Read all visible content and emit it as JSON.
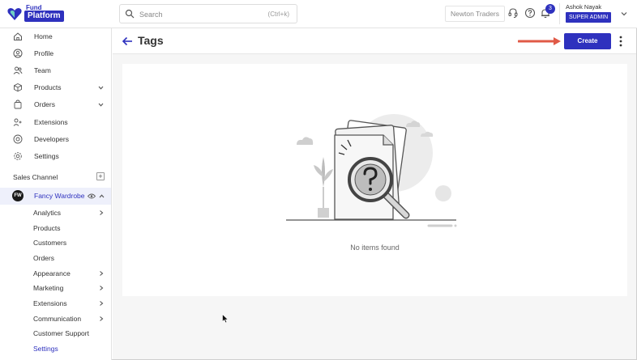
{
  "app": {
    "logo_top": "Fund",
    "logo_main": "Platform"
  },
  "header": {
    "search_placeholder": "Search",
    "search_shortcut": "(Ctrl+k)",
    "org_name": "Newton Traders",
    "notification_count": "3",
    "user_name": "Ashok Nayak",
    "user_role": "SUPER ADMIN"
  },
  "sidebar": {
    "items": [
      {
        "label": "Home",
        "icon": "home-icon"
      },
      {
        "label": "Profile",
        "icon": "profile-icon"
      },
      {
        "label": "Team",
        "icon": "team-icon"
      },
      {
        "label": "Products",
        "icon": "box-icon"
      },
      {
        "label": "Orders",
        "icon": "bag-icon"
      },
      {
        "label": "Extensions",
        "icon": "extensions-icon"
      },
      {
        "label": "Developers",
        "icon": "developers-icon"
      },
      {
        "label": "Settings",
        "icon": "gear-icon"
      }
    ],
    "section_label": "Sales Channel",
    "store_name": "Fancy Wardrobe",
    "store_logo_text": "FW",
    "sub_items": [
      {
        "label": "Analytics"
      },
      {
        "label": "Products"
      },
      {
        "label": "Customers"
      },
      {
        "label": "Orders"
      },
      {
        "label": "Appearance"
      },
      {
        "label": "Marketing"
      },
      {
        "label": "Extensions"
      },
      {
        "label": "Communication"
      },
      {
        "label": "Customer Support"
      },
      {
        "label": "Settings"
      }
    ]
  },
  "main": {
    "title": "Tags",
    "create_label": "Create",
    "empty_message": "No items found"
  },
  "colors": {
    "brand": "#2e31be",
    "annotation_arrow": "#e05a47"
  }
}
